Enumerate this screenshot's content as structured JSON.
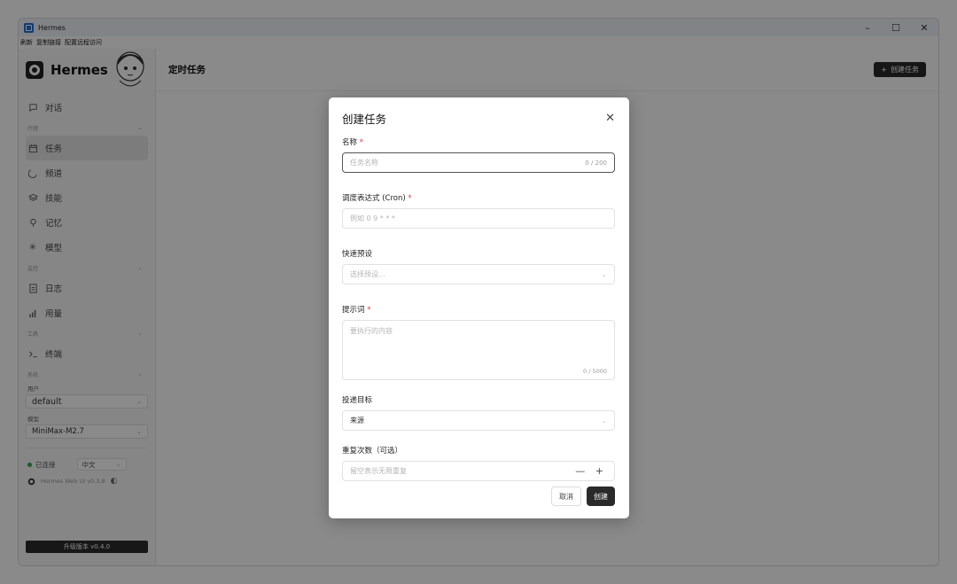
{
  "window": {
    "title": "Hermes",
    "minimize": "–",
    "maximize": "☐",
    "close": "✕"
  },
  "menubar": [
    "刷新",
    "复制链接",
    "配置远程访问"
  ],
  "sidebar": {
    "brand": "Hermes",
    "chat": "对话",
    "sections": {
      "agent": "代理",
      "monitor": "监控",
      "tools": "工具",
      "system": "系统"
    },
    "items": {
      "tasks": "任务",
      "channels": "频道",
      "skills": "技能",
      "memory": "记忆",
      "models": "模型",
      "logs": "日志",
      "usage": "用量",
      "terminal": "终端"
    },
    "user_label": "用户",
    "user_value": "default",
    "model_label": "模型",
    "model_value": "MiniMax-M2.7",
    "status": "已连接",
    "language": "中文",
    "version": "Hermes Web UI v0.3.8",
    "upgrade": "升级版本 v0.4.0"
  },
  "main": {
    "title": "定时任务",
    "create_button": "创建任务"
  },
  "modal": {
    "title": "创建任务",
    "name_label": "名称",
    "name_placeholder": "任务名称",
    "name_counter": "0 / 200",
    "cron_label": "调度表达式 (Cron)",
    "cron_placeholder": "例如 0 9 * * *",
    "preset_label": "快速预设",
    "preset_placeholder": "选择预设...",
    "prompt_label": "提示词",
    "prompt_placeholder": "要执行的内容",
    "prompt_counter": "0 / 5000",
    "target_label": "投递目标",
    "target_value": "来源",
    "repeat_label": "重复次数（可选）",
    "repeat_placeholder": "留空表示无限重复",
    "stepper": "— +",
    "cancel": "取消",
    "create": "创建",
    "required_mark": "*"
  }
}
